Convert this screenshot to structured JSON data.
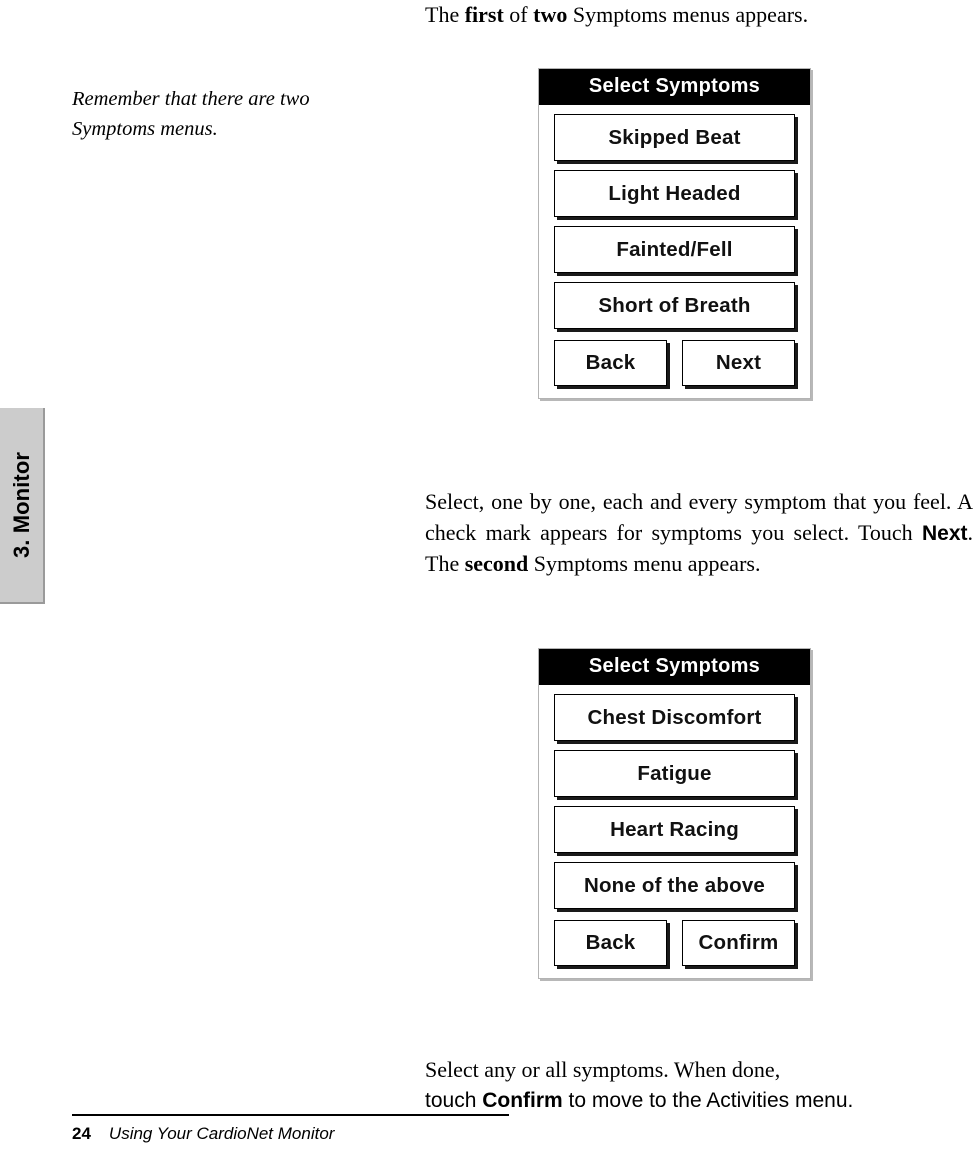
{
  "page": {
    "number": "24",
    "running_title": "Using Your CardioNet Monitor",
    "chapter_tab": "3. Monitor"
  },
  "margin_note": {
    "text": "Remember that there are two Symptoms menus."
  },
  "paragraphs": {
    "intro": {
      "part1": "The ",
      "bold1": "first",
      "part2": " of ",
      "bold2": "two",
      "part3": " Symptoms menus appears."
    },
    "middle": {
      "part1": "Select, one by one, each and every symptom that you feel. A check mark appears for symptoms you select. Touch ",
      "bold_sans": "Next",
      "part2": ".  The ",
      "bold_serif": "second",
      "part3": " Symptoms menu appears."
    },
    "closing": {
      "line1": "Select any or all symptoms.  When done,",
      "line2_part1": "touch ",
      "line2_bold": "Confirm",
      "line2_part2": " to move to the Activities menu."
    }
  },
  "screens": [
    {
      "id": "symptoms-menu-1",
      "title": "Select Symptoms",
      "buttons": [
        "Skipped Beat",
        "Light Headed",
        "Fainted/Fell",
        "Short of Breath"
      ],
      "nav": {
        "back": "Back",
        "forward": "Next"
      }
    },
    {
      "id": "symptoms-menu-2",
      "title": "Select Symptoms",
      "buttons": [
        "Chest Discomfort",
        "Fatigue",
        "Heart Racing",
        "None of the above"
      ],
      "nav": {
        "back": "Back",
        "forward": "Confirm"
      }
    }
  ],
  "colors": {
    "tab_background": "#cccccc",
    "titlebar_background": "#000000",
    "titlebar_text": "#ffffff",
    "device_frame": "#b3b3b3",
    "page_background": "#ffffff"
  }
}
